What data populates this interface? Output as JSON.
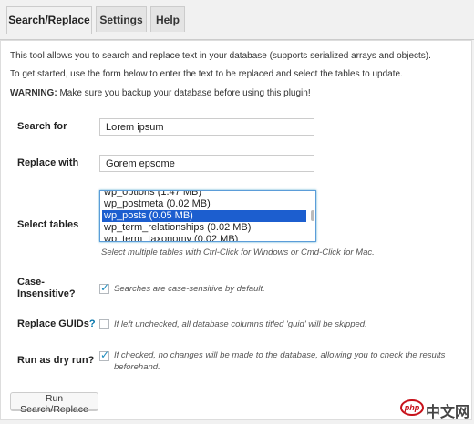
{
  "tabs": [
    {
      "label": "Search/Replace",
      "active": true
    },
    {
      "label": "Settings",
      "active": false
    },
    {
      "label": "Help",
      "active": false
    }
  ],
  "intro": {
    "line1": "This tool allows you to search and replace text in your database (supports serialized arrays and objects).",
    "line2": "To get started, use the form below to enter the text to be replaced and select the tables to update.",
    "warning_prefix": "WARNING:",
    "warning_text": " Make sure you backup your database before using this plugin!"
  },
  "form": {
    "search_label": "Search for",
    "search_value": "Lorem ipsum",
    "replace_label": "Replace with",
    "replace_value": "Gorem epsome",
    "tables_label": "Select tables",
    "tables": [
      {
        "label": "wp_options (1.47 MB)",
        "selected": false
      },
      {
        "label": "wp_postmeta (0.02 MB)",
        "selected": false
      },
      {
        "label": "wp_posts (0.05 MB)",
        "selected": true
      },
      {
        "label": "wp_term_relationships (0.02 MB)",
        "selected": false
      },
      {
        "label": "wp_term_taxonomy (0.02 MB)",
        "selected": false
      }
    ],
    "tables_hint": "Select multiple tables with Ctrl-Click for Windows or Cmd-Click for Mac.",
    "case_label_1": "Case-",
    "case_label_2": "Insensitive?",
    "case_checked": true,
    "case_hint": "Searches are case-sensitive by default.",
    "guids_label": "Replace GUIDs",
    "guids_help": "?",
    "guids_checked": false,
    "guids_hint": "If left unchecked, all database columns titled 'guid' will be skipped.",
    "dry_label": "Run as dry run?",
    "dry_checked": true,
    "dry_hint_1": "If checked, no changes will be made to the database, allowing you to check the results",
    "dry_hint_2": "beforehand.",
    "submit_label": "Run Search/Replace"
  },
  "watermark": {
    "badge": "php",
    "text": "中文网"
  },
  "colors": {
    "selected_row": "#1c5ecf",
    "checkbox_check": "#1e8cbe",
    "link": "#0073aa",
    "watermark_red": "#c7111a"
  }
}
